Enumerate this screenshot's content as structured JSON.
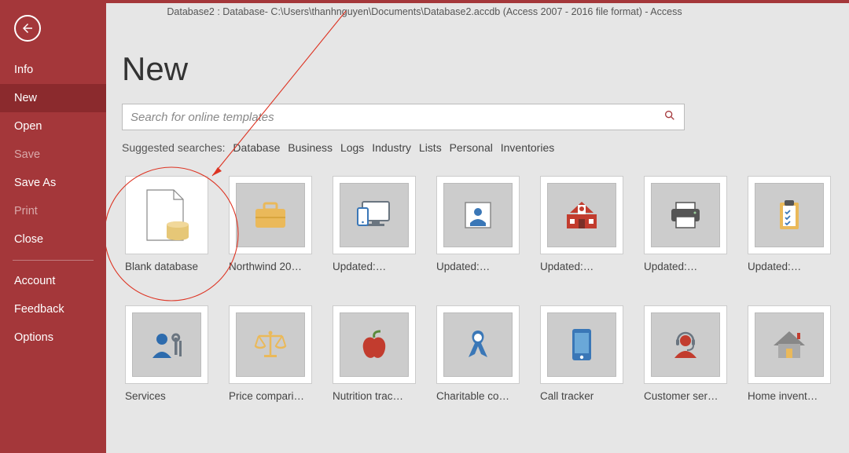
{
  "titlebar": "Database2 : Database- C:\\Users\\thanhnguyen\\Documents\\Database2.accdb (Access 2007 - 2016 file format)   -   Access",
  "sidebar": {
    "items": [
      {
        "label": "Info",
        "disabled": false
      },
      {
        "label": "New",
        "disabled": false,
        "active": true
      },
      {
        "label": "Open",
        "disabled": false
      },
      {
        "label": "Save",
        "disabled": true
      },
      {
        "label": "Save As",
        "disabled": false
      },
      {
        "label": "Print",
        "disabled": true
      },
      {
        "label": "Close",
        "disabled": false
      }
    ],
    "items2": [
      {
        "label": "Account"
      },
      {
        "label": "Feedback"
      },
      {
        "label": "Options"
      }
    ]
  },
  "page": {
    "title": "New",
    "search_placeholder": "Search for online templates",
    "suggest_label": "Suggested searches:",
    "suggestions": [
      "Database",
      "Business",
      "Logs",
      "Industry",
      "Lists",
      "Personal",
      "Inventories"
    ]
  },
  "templates": [
    {
      "label": "Blank database",
      "icon": "blank-db"
    },
    {
      "label": "Northwind 20…",
      "icon": "briefcase"
    },
    {
      "label": "Updated:…",
      "icon": "devices"
    },
    {
      "label": "Updated:…",
      "icon": "contact"
    },
    {
      "label": "Updated:…",
      "icon": "school"
    },
    {
      "label": "Updated:…",
      "icon": "printer"
    },
    {
      "label": "Updated:…",
      "icon": "clipboard"
    },
    {
      "label": "Services",
      "icon": "user-wrench"
    },
    {
      "label": "Price compari…",
      "icon": "scales"
    },
    {
      "label": "Nutrition trac…",
      "icon": "apple"
    },
    {
      "label": "Charitable co…",
      "icon": "ribbon"
    },
    {
      "label": "Call tracker",
      "icon": "phone"
    },
    {
      "label": "Customer ser…",
      "icon": "headset"
    },
    {
      "label": "Home invent…",
      "icon": "house"
    }
  ]
}
